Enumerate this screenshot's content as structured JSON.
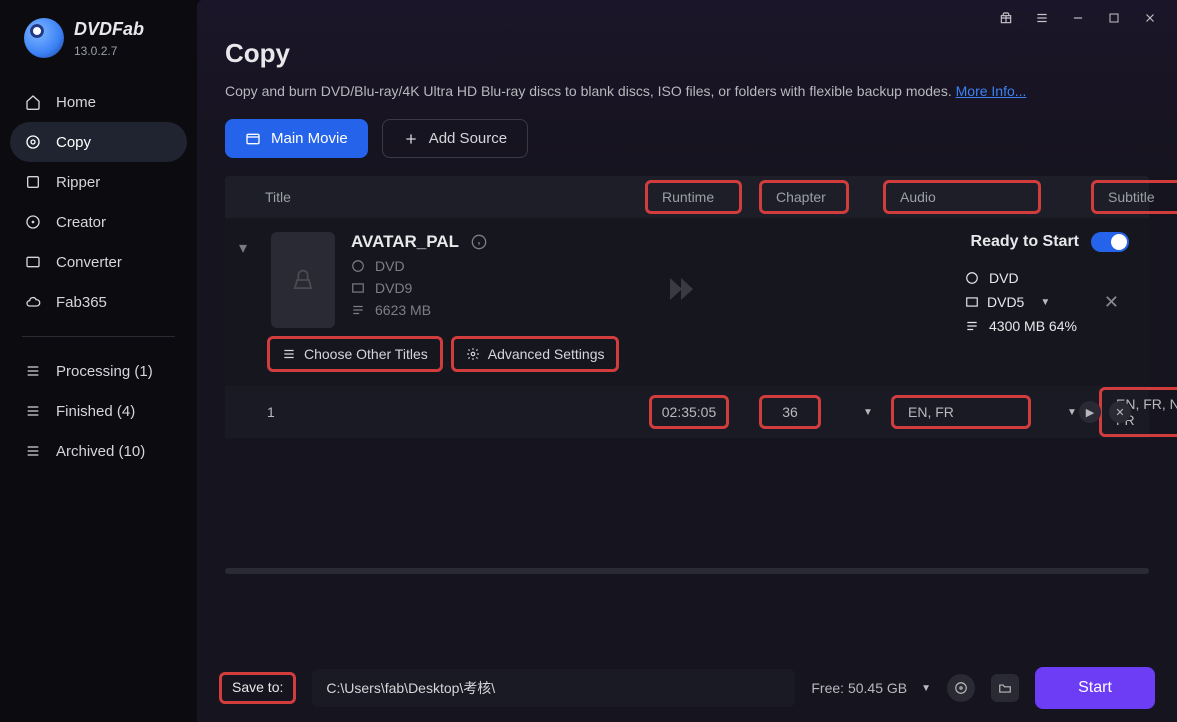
{
  "app": {
    "brand": "DVDFab",
    "version": "13.0.2.7"
  },
  "sidebar": {
    "items": [
      {
        "label": "Home"
      },
      {
        "label": "Copy"
      },
      {
        "label": "Ripper"
      },
      {
        "label": "Creator"
      },
      {
        "label": "Converter"
      },
      {
        "label": "Fab365"
      }
    ],
    "status": [
      {
        "label": "Processing (1)"
      },
      {
        "label": "Finished (4)"
      },
      {
        "label": "Archived (10)"
      }
    ]
  },
  "page": {
    "title": "Copy",
    "desc": "Copy and burn DVD/Blu-ray/4K Ultra HD Blu-ray discs to blank discs, ISO files, or folders with flexible backup modes. ",
    "more": "More Info..."
  },
  "toolbar": {
    "main_movie": "Main Movie",
    "add_source": "Add Source"
  },
  "columns": {
    "title": "Title",
    "runtime": "Runtime",
    "chapter": "Chapter",
    "audio": "Audio",
    "subtitle": "Subtitle"
  },
  "source": {
    "name": "AVATAR_PAL",
    "in_type": "DVD",
    "in_format": "DVD9",
    "in_size": "6623 MB",
    "out_type": "DVD",
    "out_format": "DVD5",
    "out_size": "4300 MB 64%",
    "ready": "Ready to Start",
    "choose_other": "Choose Other Titles",
    "advanced": "Advanced Settings"
  },
  "title_row": {
    "index": "1",
    "runtime": "02:35:05",
    "chapter": "36",
    "audio": "EN, FR",
    "subtitle": "EN, FR, NL, EN, FR"
  },
  "footer": {
    "save_to_label": "Save to:",
    "path": "C:\\Users\\fab\\Desktop\\考核\\",
    "free": "Free: 50.45 GB",
    "start": "Start"
  }
}
